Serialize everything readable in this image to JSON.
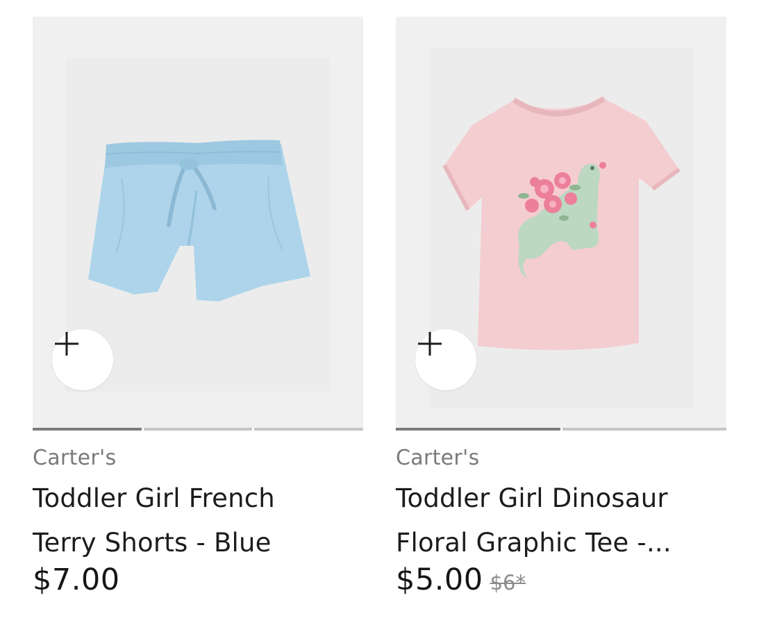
{
  "products": [
    {
      "brand": "Carter's",
      "title_line1": "Toddler Girl French",
      "title_line2": "Terry Shorts - Blue",
      "price": "$7.00",
      "original_price": null,
      "image": "light-blue-terry-shorts",
      "carousel": {
        "count": 3,
        "active": 0
      },
      "add_icon": "plus-icon"
    },
    {
      "brand": "Carter's",
      "title_line1": "Toddler Girl Dinosaur",
      "title_line2": "Floral Graphic Tee -...",
      "price": "$5.00",
      "original_price": "$6*",
      "image": "pink-dinosaur-floral-tee",
      "carousel": {
        "count": 2,
        "active": 0
      },
      "add_icon": "plus-icon"
    }
  ],
  "colors": {
    "panel_background": "#f0f0f0",
    "shorts": "#add4ea",
    "tee": "#f4cdd0",
    "dinosaur": "#bcd8c1",
    "flowers": "#ec7f9a",
    "indicator_active": "#7c7c7c",
    "indicator_inactive": "#c6c6c6"
  }
}
